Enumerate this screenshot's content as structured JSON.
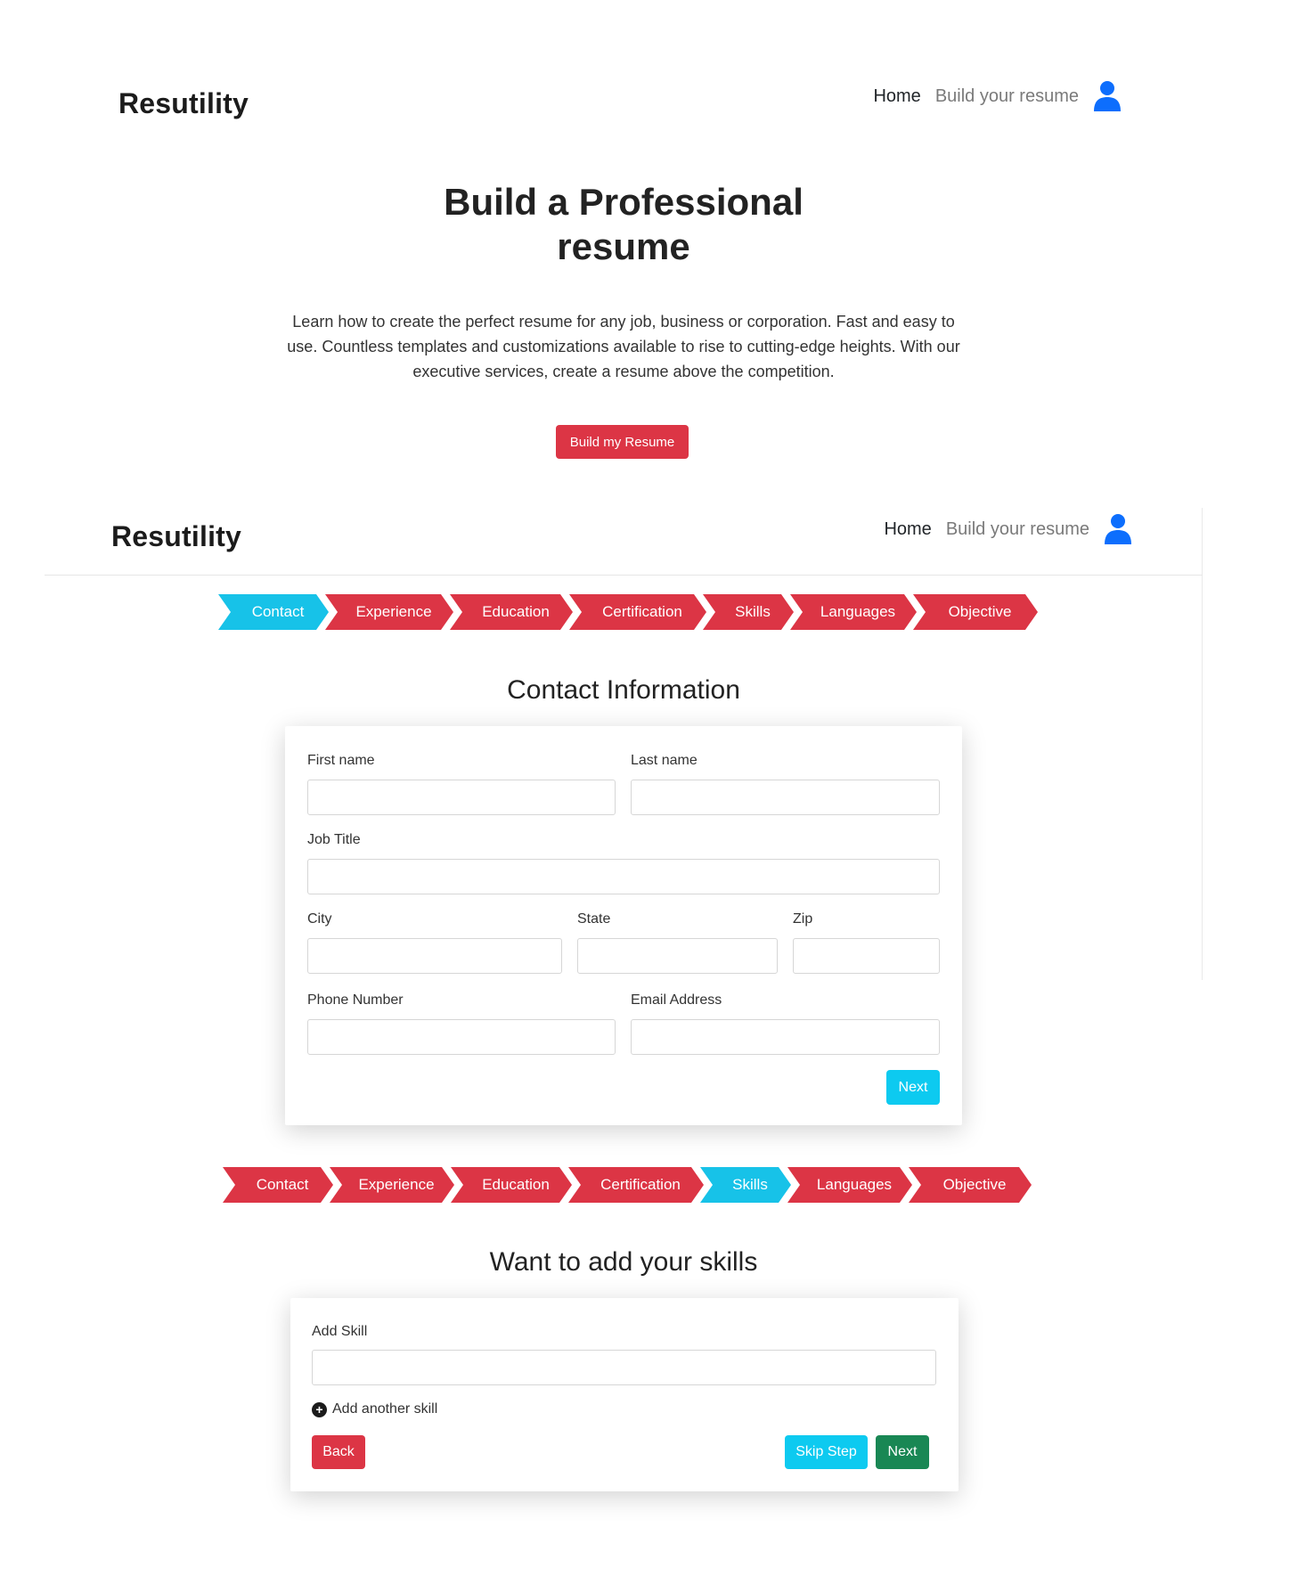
{
  "landing": {
    "brand": "Resutility",
    "nav": {
      "home": "Home",
      "build": "Build your resume",
      "user_icon": "user-icon"
    },
    "hero_title": "Build a Professional resume",
    "hero_text": "Learn how to create the perfect resume for any job, business or corporation. Fast and easy to use. Countless templates and customizations available to rise to cutting-edge heights. With our executive services, create a resume above the competition.",
    "cta": "Build my Resume"
  },
  "builder": {
    "brand": "Resutility",
    "nav": {
      "home": "Home",
      "build": "Build your resume",
      "user_icon": "user-icon"
    },
    "steps": [
      "Contact",
      "Experience",
      "Education",
      "Certification",
      "Skills",
      "Languages",
      "Objective"
    ],
    "contact": {
      "title": "Contact Information",
      "first_name": "First name",
      "last_name": "Last name",
      "job_title": "Job Title",
      "city": "City",
      "state": "State",
      "zip": "Zip",
      "phone": "Phone Number",
      "email": "Email Address",
      "next": "Next"
    },
    "skills": {
      "title": "Want to add your skills",
      "add_skill": "Add Skill",
      "add_another": "Add another skill",
      "back": "Back",
      "skip": "Skip Step",
      "next": "Next"
    }
  },
  "colors": {
    "red": "#dc3545",
    "cyan": "#0dcaf0",
    "green": "#198754",
    "blue": "#0d6efd"
  }
}
